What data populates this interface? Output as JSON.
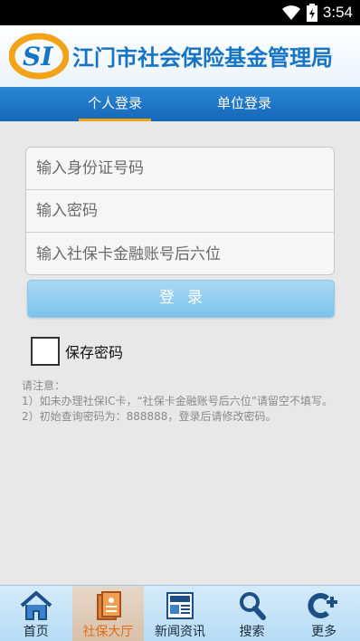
{
  "status": {
    "time": "3:54"
  },
  "header": {
    "title": "江门市社会保险基金管理局",
    "logo_text": "SI"
  },
  "tabs": [
    {
      "label": "个人登录",
      "active": true
    },
    {
      "label": "单位登录",
      "active": false
    }
  ],
  "form": {
    "id_placeholder": "输入身份证号码",
    "password_placeholder": "输入密码",
    "bank_placeholder": "输入社保卡金融账号后六位",
    "login_label": "登录",
    "remember_label": "保存密码"
  },
  "notes": {
    "title": "请注意：",
    "line1": "1）如未办理社保IC卡，“社保卡金融账号后六位”请留空不填写。",
    "line2": "2）初始查询密码为：888888，登录后请修改密码。"
  },
  "bottom_nav": [
    {
      "label": "首页",
      "icon": "home-icon",
      "active": false
    },
    {
      "label": "社保大厅",
      "icon": "document-icon",
      "active": true
    },
    {
      "label": "新闻资讯",
      "icon": "news-icon",
      "active": false
    },
    {
      "label": "搜索",
      "icon": "search-icon",
      "active": false
    },
    {
      "label": "更多",
      "icon": "more-icon",
      "active": false
    }
  ],
  "colors": {
    "brand_blue": "#1574c4",
    "tab_indicator": "#f2a31a",
    "button": "#7cc3ec",
    "logo_orange": "#f2a31a"
  }
}
